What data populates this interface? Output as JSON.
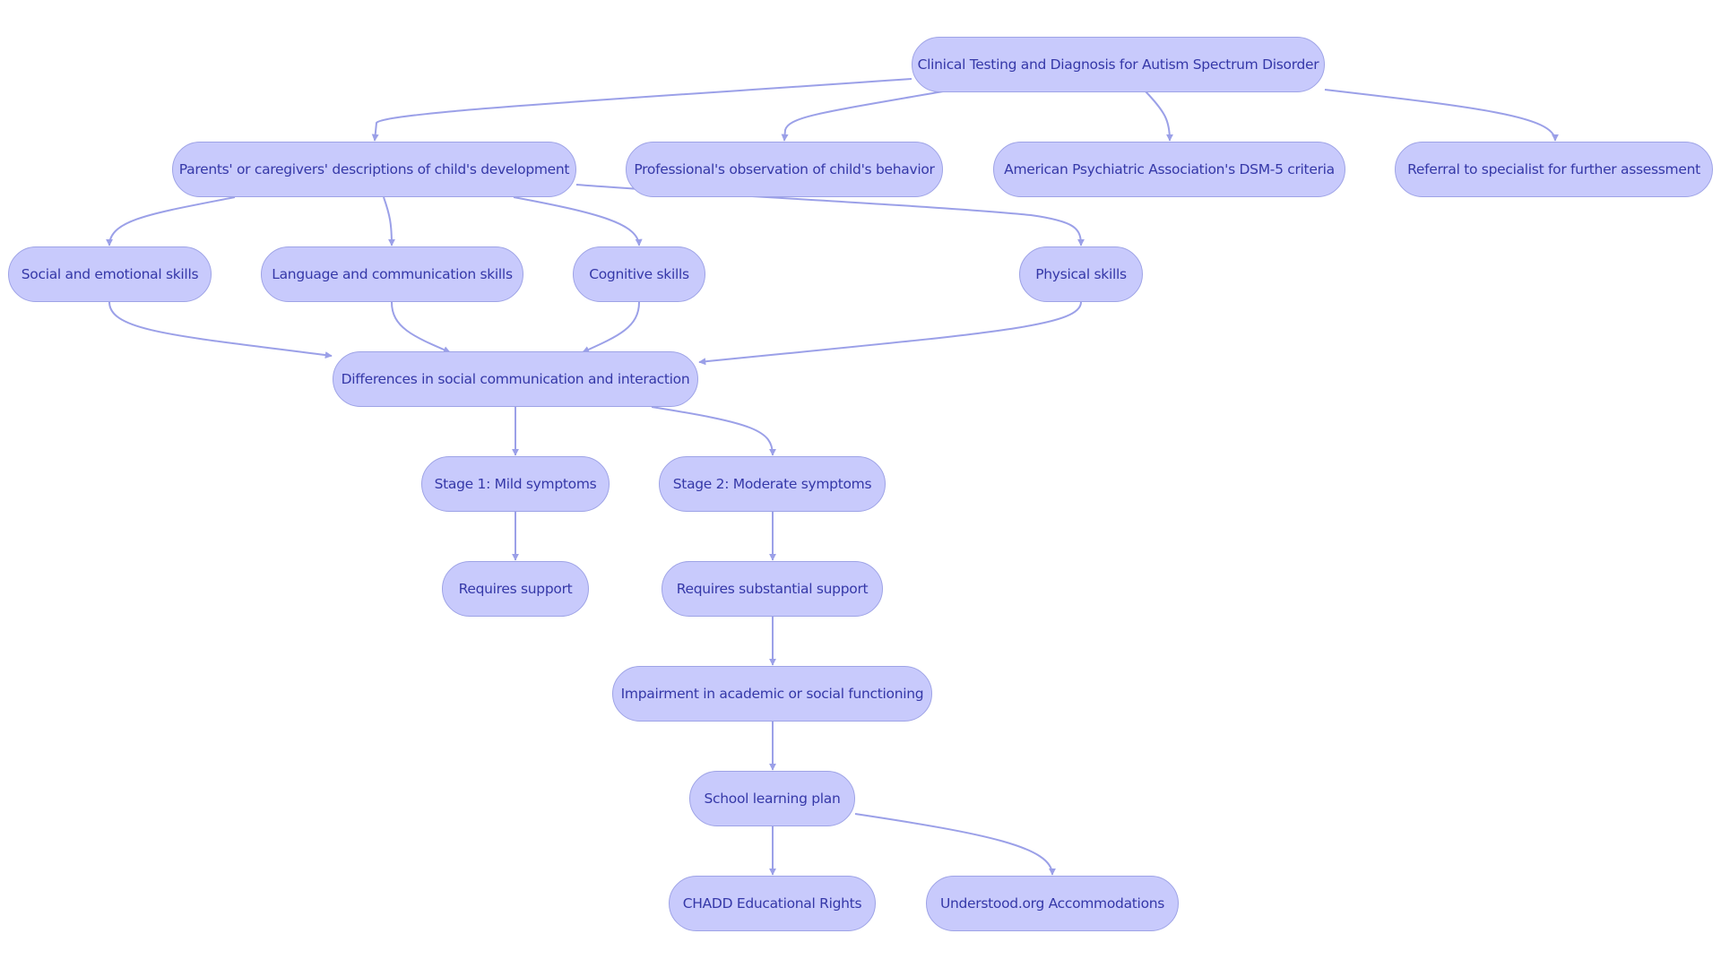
{
  "diagram": {
    "type": "flowchart",
    "direction": "top-down",
    "colors": {
      "node_fill": "#c8cafc",
      "node_border": "#9ea3e6",
      "node_text": "#3538a8",
      "edge": "#9ba0e8"
    },
    "nodes": [
      {
        "id": "root",
        "label": "Clinical Testing and Diagnosis for Autism Spectrum Disorder"
      },
      {
        "id": "parents",
        "label": "Parents' or caregivers' descriptions of child's development"
      },
      {
        "id": "professional",
        "label": "Professional's observation of child's behavior"
      },
      {
        "id": "apa",
        "label": "American Psychiatric Association's DSM-5 criteria"
      },
      {
        "id": "referral",
        "label": "Referral to specialist for further assessment"
      },
      {
        "id": "social",
        "label": "Social and emotional skills"
      },
      {
        "id": "language",
        "label": "Language and communication skills"
      },
      {
        "id": "cognitive",
        "label": "Cognitive skills"
      },
      {
        "id": "physical",
        "label": "Physical skills"
      },
      {
        "id": "differences",
        "label": "Differences in social communication and interaction"
      },
      {
        "id": "stage1",
        "label": "Stage 1: Mild symptoms"
      },
      {
        "id": "stage2",
        "label": "Stage 2: Moderate symptoms"
      },
      {
        "id": "req1",
        "label": "Requires support"
      },
      {
        "id": "req2",
        "label": "Requires substantial support"
      },
      {
        "id": "impairment",
        "label": "Impairment in academic or social functioning"
      },
      {
        "id": "school",
        "label": "School learning plan"
      },
      {
        "id": "chadd",
        "label": "CHADD Educational Rights"
      },
      {
        "id": "understood",
        "label": "Understood.org Accommodations"
      }
    ],
    "edges": [
      {
        "from": "root",
        "to": "parents"
      },
      {
        "from": "root",
        "to": "professional"
      },
      {
        "from": "root",
        "to": "apa"
      },
      {
        "from": "root",
        "to": "referral"
      },
      {
        "from": "parents",
        "to": "social"
      },
      {
        "from": "parents",
        "to": "language"
      },
      {
        "from": "parents",
        "to": "cognitive"
      },
      {
        "from": "parents",
        "to": "physical"
      },
      {
        "from": "social",
        "to": "differences"
      },
      {
        "from": "language",
        "to": "differences"
      },
      {
        "from": "cognitive",
        "to": "differences"
      },
      {
        "from": "physical",
        "to": "differences"
      },
      {
        "from": "differences",
        "to": "stage1"
      },
      {
        "from": "differences",
        "to": "stage2"
      },
      {
        "from": "stage1",
        "to": "req1"
      },
      {
        "from": "stage2",
        "to": "req2"
      },
      {
        "from": "req2",
        "to": "impairment"
      },
      {
        "from": "impairment",
        "to": "school"
      },
      {
        "from": "school",
        "to": "chadd"
      },
      {
        "from": "school",
        "to": "understood"
      }
    ]
  }
}
